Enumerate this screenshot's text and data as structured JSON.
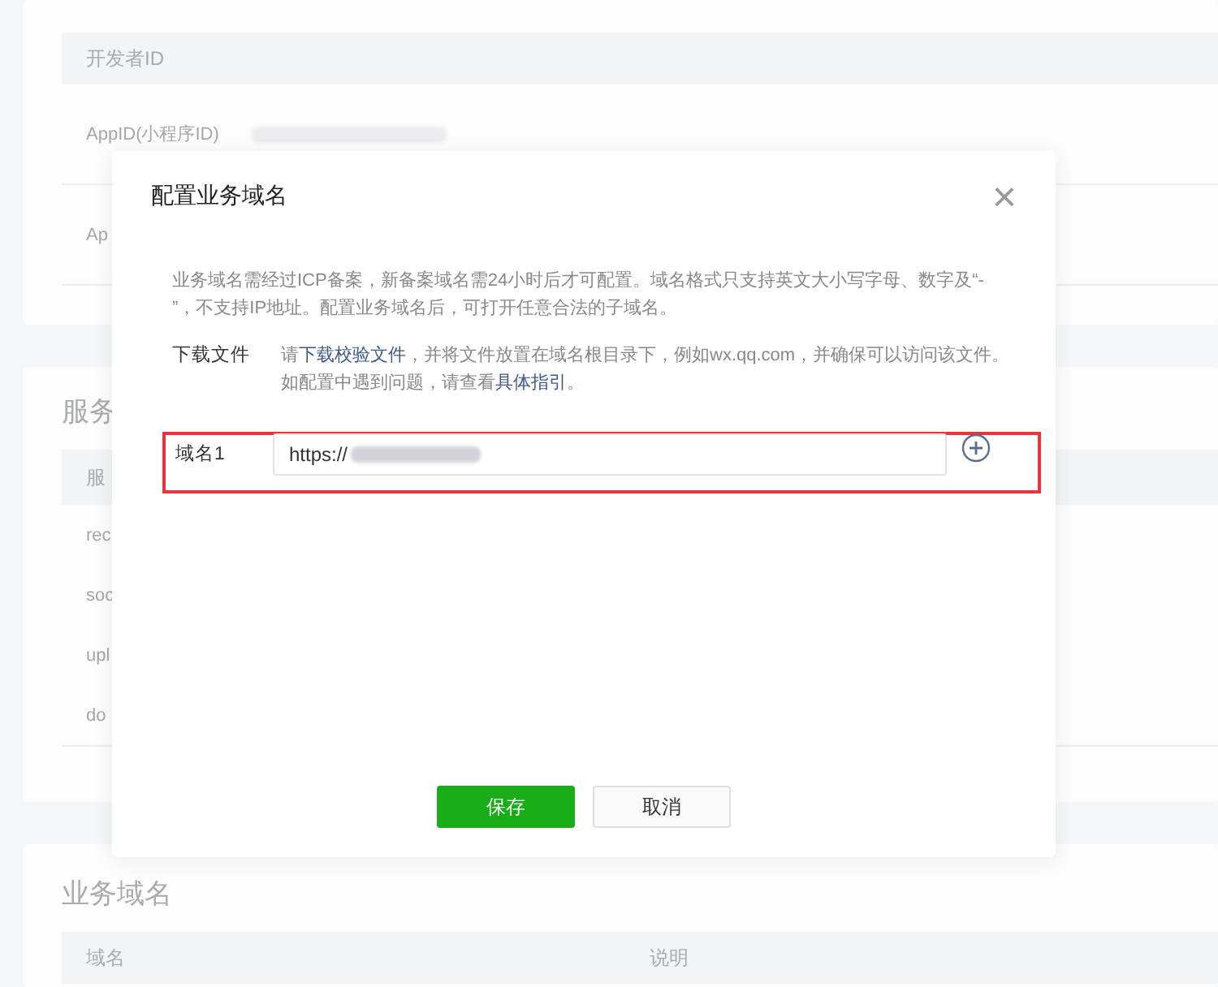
{
  "background": {
    "developer_card": {
      "header": "开发者ID",
      "rows": [
        {
          "label": "AppID(小程序ID)",
          "redacted": true
        },
        {
          "label": "Ap"
        }
      ]
    },
    "server_card": {
      "title": "服务",
      "header": "服",
      "rows": [
        "rec",
        "soc",
        "upl",
        "do"
      ]
    },
    "business_card": {
      "title": "业务域名",
      "columns": [
        "域名",
        "说明"
      ]
    }
  },
  "dialog": {
    "title": "配置业务域名",
    "close": "×",
    "description": "业务域名需经过ICP备案，新备案域名需24小时后才可配置。域名格式只支持英文大小写字母、数字及“- ”，不支持IP地址。配置业务域名后，可打开任意合法的子域名。",
    "download": {
      "label": "下载文件",
      "before": "请",
      "link1": "下载校验文件",
      "middle": "，并将文件放置在域名根目录下，例如wx.qq.com，并确保可以访问该文件。如配置中遇到问题，请查看",
      "link2": "具体指引",
      "after": "。"
    },
    "domains": [
      {
        "label": "域名1",
        "value": "https://",
        "redacted": true,
        "highlighted": true
      }
    ],
    "buttons": [
      {
        "label": "保存",
        "kind": "primary"
      },
      {
        "label": "取消",
        "kind": "default"
      }
    ]
  }
}
